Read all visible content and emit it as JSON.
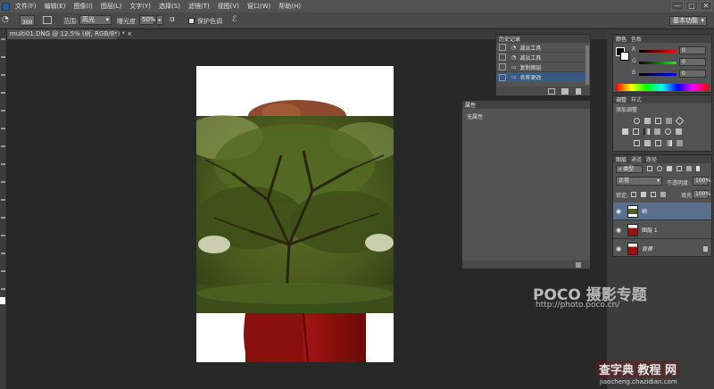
{
  "menubar": {
    "app_icon": "photoshop-icon",
    "items": [
      "文件(F)",
      "编辑(E)",
      "图像(I)",
      "图层(L)",
      "文字(Y)",
      "选择(S)",
      "滤镜(T)",
      "视图(V)",
      "窗口(W)",
      "帮助(H)"
    ],
    "controls": [
      "—",
      "▢",
      "✕"
    ]
  },
  "options": {
    "brush_size": "300",
    "range_label": "范围:",
    "range_value": "高光",
    "exposure_label": "曝光度:",
    "exposure_value": "50%",
    "protect_tone": "保护色调",
    "workspace": "基本功能"
  },
  "document": {
    "tab_title": "multi01.DNG @ 12.5% (树, RGB/8*) *",
    "tab_close": "×"
  },
  "history": {
    "tab": "历史记录",
    "items": [
      "减淡工具",
      "减淡工具",
      "复制图层",
      "名称更改"
    ]
  },
  "properties": {
    "tab": "属性",
    "empty_text": "无属性"
  },
  "color": {
    "tabs": [
      "颜色",
      "色板"
    ],
    "channels": [
      {
        "label": "R",
        "value": "0"
      },
      {
        "label": "G",
        "value": "0"
      },
      {
        "label": "B",
        "value": "0"
      }
    ]
  },
  "adjustments": {
    "tabs": [
      "调整",
      "样式"
    ],
    "title": "添加调整"
  },
  "layers": {
    "tabs": [
      "图层",
      "通道",
      "路径"
    ],
    "filter_kind": "类型",
    "blend_mode": "正常",
    "opacity_label": "不透明度:",
    "opacity_value": "100%",
    "lock_label": "锁定:",
    "fill_label": "填充:",
    "fill_value": "100%",
    "items": [
      {
        "name": "树",
        "selected": true
      },
      {
        "name": "图层 1",
        "selected": false
      },
      {
        "name": "背景",
        "selected": false
      }
    ]
  },
  "watermark": {
    "line1": "POCO 摄影专题",
    "line2": "http://photo.poco.cn/",
    "line3": "查字典 教程 网",
    "line4": "jiaocheng.chazidian.com"
  },
  "colors": {
    "menubar": "#535353",
    "panel": "#535353",
    "selected_layer": "#5a6f8e",
    "history_selected": "#3a5a85"
  }
}
